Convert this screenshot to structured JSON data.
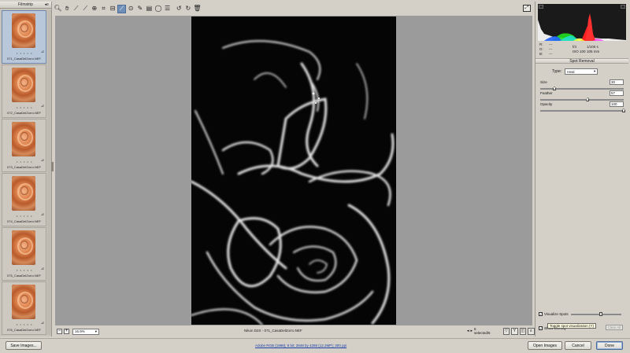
{
  "filmstrip": {
    "title": "Filmstrip",
    "collapse_icon": "collapse-arrow-icon",
    "items": [
      {
        "filename": "071_CasaDelZorro.NEF",
        "rating": "• • • • •",
        "selected": true
      },
      {
        "filename": "072_CasaDelZorro.NEF",
        "rating": "• • • • •",
        "selected": false
      },
      {
        "filename": "073_CasaDelZorro.NEF",
        "rating": "• • • • •",
        "selected": false
      },
      {
        "filename": "074_CasaDelZorro.NEF",
        "rating": "• • • • •",
        "selected": false
      },
      {
        "filename": "075_CasaDelZorro.NEF",
        "rating": "• • • • •",
        "selected": false
      },
      {
        "filename": "076_CasaDelZorro.NEF",
        "rating": "• • • • •",
        "selected": false
      }
    ]
  },
  "toolbar": {
    "tools": [
      "zoom-icon",
      "hand-icon",
      "white-balance-icon",
      "color-sampler-icon",
      "targeted-adjustment-icon",
      "crop-icon",
      "straighten-icon",
      "spot-removal-icon",
      "red-eye-icon",
      "adjustment-brush-icon",
      "graduated-filter-icon",
      "radial-filter-icon",
      "preferences-icon",
      "rotate-left-icon",
      "rotate-right-icon",
      "trash-icon"
    ],
    "active_tool": "spot-removal-icon",
    "fullscreen_icon": "fullscreen-toggle-icon"
  },
  "status_bar": {
    "zoom_value": "16.9%",
    "camera_file": "Nikon D2X  -  071_CasaDelZorro.NEF",
    "selection_count": "6 selected/6"
  },
  "histogram": {
    "accent_colors": [
      "#ff2020",
      "#20e020",
      "#2060ff"
    ]
  },
  "readout": {
    "r_label": "R:",
    "r_value": "---",
    "g_label": "G:",
    "g_value": "---",
    "b_label": "B:",
    "b_value": "---",
    "aperture": "f/4",
    "shutter": "1/100 s",
    "iso": "ISO 100",
    "focal": "105 mm"
  },
  "spot_removal": {
    "title": "Spot Removal",
    "type_label": "Type:",
    "type_value": "Heal",
    "size_label": "Size",
    "size_value": "30",
    "size_fraction": 0.17,
    "feather_label": "Feather",
    "feather_value": "57",
    "feather_fraction": 0.57,
    "opacity_label": "Opacity",
    "opacity_value": "100",
    "opacity_fraction": 1.0
  },
  "bottom_panel": {
    "visualize_label": "Visualize Spots",
    "visualize_checked": "✓",
    "visualize_fraction": 0.6,
    "show_overlay_label": "Show Overlay",
    "show_overlay_checked": "✓",
    "tooltip": "Toggle spot visualization (Y)",
    "clear_all": "Clear All"
  },
  "footer": {
    "save_images": "Save Images...",
    "workflow": "Adobe RGB (1998); 8 bit; 2848 by 4288 (12.2MP); 300 ppi",
    "open_images": "Open Images",
    "cancel": "Cancel",
    "done": "Done"
  }
}
